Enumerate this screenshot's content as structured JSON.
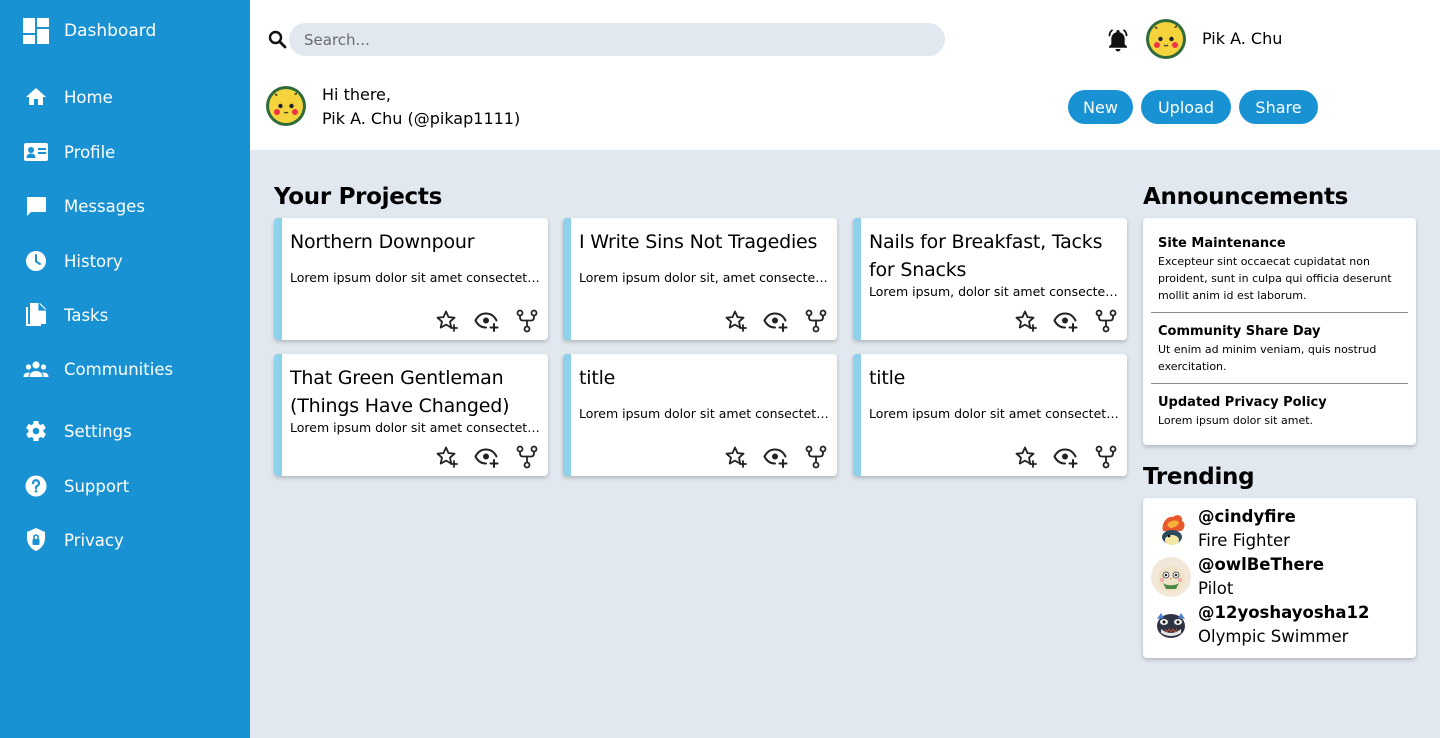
{
  "sidebar": {
    "brand": {
      "label": "Dashboard",
      "icon": "dashboard-icon"
    },
    "items": [
      {
        "label": "Home",
        "icon": "home-icon"
      },
      {
        "label": "Profile",
        "icon": "profile-card-icon"
      },
      {
        "label": "Messages",
        "icon": "message-icon"
      },
      {
        "label": "History",
        "icon": "clock-icon"
      },
      {
        "label": "Tasks",
        "icon": "tasks-icon"
      },
      {
        "label": "Communities",
        "icon": "group-icon"
      },
      {
        "label": "Settings",
        "icon": "gear-icon"
      },
      {
        "label": "Support",
        "icon": "help-icon"
      },
      {
        "label": "Privacy",
        "icon": "shield-icon"
      }
    ]
  },
  "header": {
    "search": {
      "placeholder": "Search...",
      "value": ""
    },
    "user_name": "Pik A. Chu",
    "greeting": "Hi there,",
    "greeting_user": "Pik A. Chu (@pikap1111)",
    "buttons": {
      "new": "New",
      "upload": "Upload",
      "share": "Share"
    }
  },
  "projects": {
    "title": "Your Projects",
    "cards": [
      {
        "title": "Northern Downpour",
        "desc": "Lorem ipsum dolor sit amet consectetur adipiscing elit"
      },
      {
        "title": "I Write Sins Not Tragedies",
        "desc": "Lorem ipsum dolor sit, amet consectetur adipisicing elit"
      },
      {
        "title": "Nails for Breakfast, Tacks for Snacks",
        "desc": "Lorem ipsum, dolor sit amet consectetur adipisicing elit"
      },
      {
        "title": "That Green Gentleman (Things Have Changed)",
        "desc": "Lorem ipsum dolor sit amet consectetur adipiscing elit"
      },
      {
        "title": "title",
        "desc": "Lorem ipsum dolor sit amet consectetur adipiscing elit"
      },
      {
        "title": "title",
        "desc": "Lorem ipsum dolor sit amet consectetur adipiscing elit"
      }
    ],
    "action_icons": [
      "star-add-icon",
      "watch-add-icon",
      "fork-icon"
    ]
  },
  "announcements": {
    "title": "Announcements",
    "items": [
      {
        "title": "Site Maintenance",
        "text": "Excepteur sint occaecat cupidatat non proident, sunt in culpa qui officia deserunt mollit anim id est laborum."
      },
      {
        "title": "Community Share Day",
        "text": "Ut enim ad minim veniam, quis nostrud exercitation."
      },
      {
        "title": "Updated Privacy Policy",
        "text": "Lorem ipsum dolor sit amet."
      }
    ]
  },
  "trending": {
    "title": "Trending",
    "items": [
      {
        "handle": "@cindyfire",
        "role": "Fire Fighter"
      },
      {
        "handle": "@owlBeThere",
        "role": "Pilot"
      },
      {
        "handle": "@12yoshayosha12",
        "role": "Olympic Swimmer"
      }
    ]
  },
  "colors": {
    "sidebar": "#1992d4",
    "accent": "#1992d4",
    "card_border": "#8ed1ea",
    "background": "#e2e8f0"
  }
}
